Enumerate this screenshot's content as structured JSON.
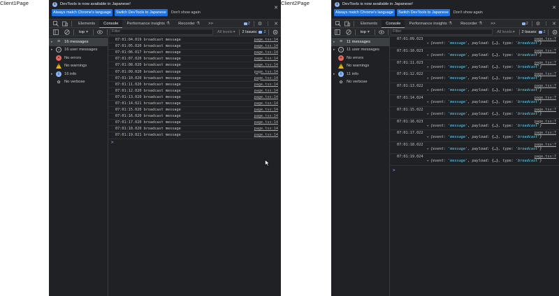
{
  "labels": {
    "client1": "Client1Page",
    "client2": "Client2Page"
  },
  "infobar": {
    "text": "DevTools is now available in Japanese!",
    "btn_match": "Always match Chrome's language",
    "btn_switch": "Switch DevTools to Japanese",
    "btn_dont": "Don't show again"
  },
  "tabs": {
    "elements": "Elements",
    "console": "Console",
    "perf": "Performance insights",
    "recorder": "Recorder",
    "more": ">>",
    "issue_count": "2"
  },
  "toolbar": {
    "context": "top",
    "filter_placeholder": "Filter",
    "levels": "All levels",
    "issues_label": "2 Issues:",
    "issues_count": "2"
  },
  "left": {
    "sidebar": [
      {
        "label": "16 messages",
        "icon": "list-icon",
        "arrow": true
      },
      {
        "label": "16 user messages",
        "icon": "user-icon",
        "arrow": true
      },
      {
        "label": "No errors",
        "icon": "error-icon",
        "arrow": false
      },
      {
        "label": "No warnings",
        "icon": "warning-icon",
        "arrow": false
      },
      {
        "label": "16 info",
        "icon": "info-icon",
        "arrow": true
      },
      {
        "label": "No verbose",
        "icon": "verbose-icon",
        "arrow": false
      }
    ],
    "logs": [
      {
        "time": "07:01:04.019",
        "msg": "broadcast message",
        "src": "page.tsx:14"
      },
      {
        "time": "07:01:05.020",
        "msg": "broadcast message",
        "src": "page.tsx:14"
      },
      {
        "time": "07:01:06.017",
        "msg": "broadcast message",
        "src": "page.tsx:14"
      },
      {
        "time": "07:01:07.020",
        "msg": "broadcast message",
        "src": "page.tsx:14"
      },
      {
        "time": "07:01:08.020",
        "msg": "broadcast message",
        "src": "page.tsx:14"
      },
      {
        "time": "07:01:09.020",
        "msg": "broadcast message",
        "src": "page.tsx:14"
      },
      {
        "time": "07:01:10.020",
        "msg": "broadcast message",
        "src": "page.tsx:14"
      },
      {
        "time": "07:01:11.020",
        "msg": "broadcast message",
        "src": "page.tsx:14"
      },
      {
        "time": "07:01:12.020",
        "msg": "broadcast message",
        "src": "page.tsx:14"
      },
      {
        "time": "07:01:13.020",
        "msg": "broadcast message",
        "src": "page.tsx:14"
      },
      {
        "time": "07:01:14.021",
        "msg": "broadcast message",
        "src": "page.tsx:14"
      },
      {
        "time": "07:01:15.020",
        "msg": "broadcast message",
        "src": "page.tsx:14"
      },
      {
        "time": "07:01:16.020",
        "msg": "broadcast message",
        "src": "page.tsx:14"
      },
      {
        "time": "07:01:17.020",
        "msg": "broadcast message",
        "src": "page.tsx:14"
      },
      {
        "time": "07:01:18.020",
        "msg": "broadcast message",
        "src": "page.tsx:14"
      },
      {
        "time": "07:01:19.021",
        "msg": "broadcast message",
        "src": "page.tsx:14"
      }
    ]
  },
  "right": {
    "sidebar": [
      {
        "label": "11 messages",
        "icon": "list-icon",
        "arrow": true
      },
      {
        "label": "11 user messages",
        "icon": "user-icon",
        "arrow": true
      },
      {
        "label": "No errors",
        "icon": "error-icon",
        "arrow": false
      },
      {
        "label": "No warnings",
        "icon": "warning-icon",
        "arrow": false
      },
      {
        "label": "11 info",
        "icon": "info-icon",
        "arrow": true
      },
      {
        "label": "No verbose",
        "icon": "verbose-icon",
        "arrow": false
      }
    ],
    "logs": [
      {
        "time": "07:01:09.023",
        "src": "page.tsx:7"
      },
      {
        "time": "07:01:10.023",
        "src": "page.tsx:7"
      },
      {
        "time": "07:01:11.023",
        "src": "page.tsx:7"
      },
      {
        "time": "07:01:12.022",
        "src": "page.tsx:7"
      },
      {
        "time": "07:01:13.022",
        "src": "page.tsx:7"
      },
      {
        "time": "07:01:14.024",
        "src": "page.tsx:7"
      },
      {
        "time": "07:01:15.022",
        "src": "page.tsx:7"
      },
      {
        "time": "07:01:16.023",
        "src": "page.tsx:7"
      },
      {
        "time": "07:01:17.022",
        "src": "page.tsx:7"
      },
      {
        "time": "07:01:18.022",
        "src": "page.tsx:7"
      },
      {
        "time": "07:01:19.024",
        "src": "page.tsx:7"
      }
    ],
    "obj_parts": {
      "open": "{event: ",
      "event_val": "'message'",
      "payload": ", payload: ",
      "ellipsis": "{…}",
      "type": ", type: ",
      "type_val": "'broadcast'",
      "close": "}"
    }
  },
  "prompt": ">"
}
